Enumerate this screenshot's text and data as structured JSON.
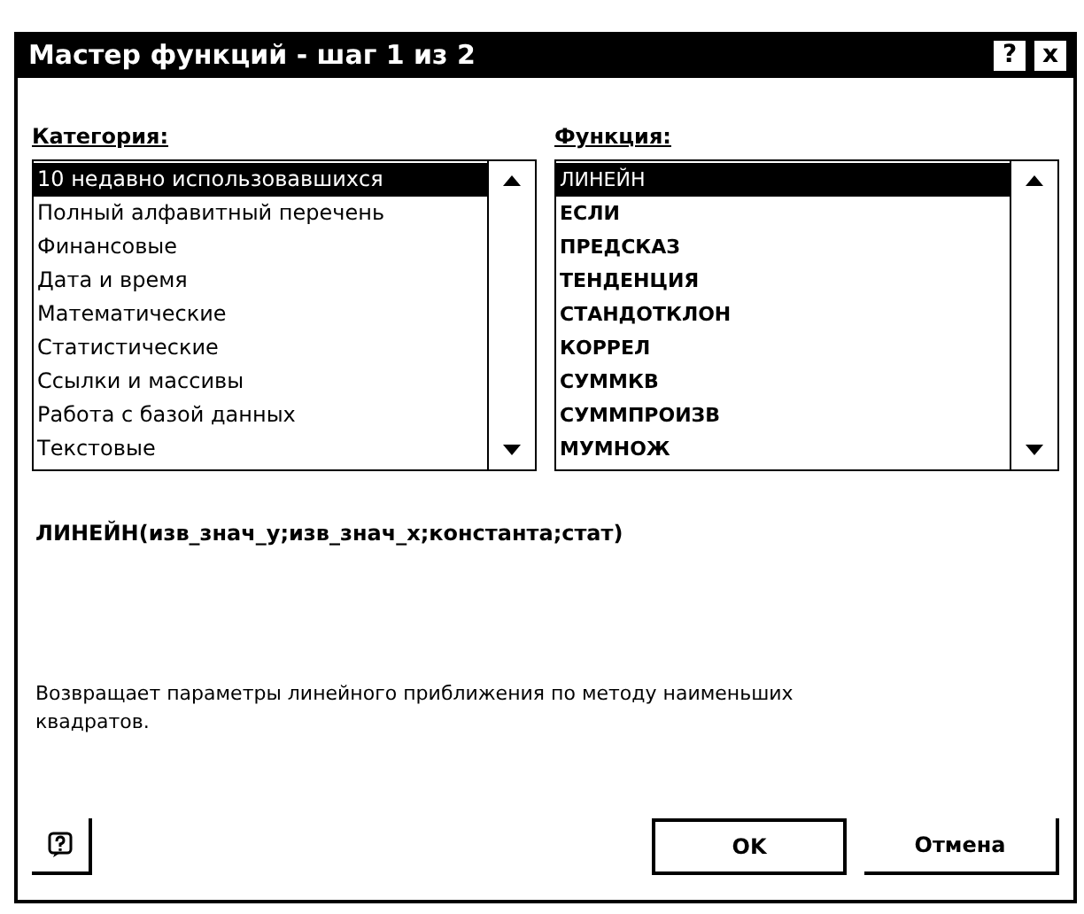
{
  "window": {
    "title": "Мастер функций - шаг 1 из 2"
  },
  "title_buttons": [
    "?",
    "x"
  ],
  "category": {
    "label": "Категория:",
    "items": [
      {
        "text": "10 недавно использовавшихся",
        "selected": true
      },
      {
        "text": "Полный алфавитный перечень",
        "selected": false
      },
      {
        "text": "Финансовые",
        "selected": false
      },
      {
        "text": "Дата и время",
        "selected": false
      },
      {
        "text": "Математические",
        "selected": false
      },
      {
        "text": "Статистические",
        "selected": false
      },
      {
        "text": "Ссылки и массивы",
        "selected": false
      },
      {
        "text": "Работа с базой данных",
        "selected": false
      },
      {
        "text": "Текстовые",
        "selected": false
      }
    ]
  },
  "function": {
    "label": "Функция:",
    "items": [
      {
        "text": "ЛИНЕЙН",
        "selected": true
      },
      {
        "text": "ЕСЛИ",
        "selected": false
      },
      {
        "text": "ПРЕДСКАЗ",
        "selected": false
      },
      {
        "text": "ТЕНДЕНЦИЯ",
        "selected": false
      },
      {
        "text": "СТАНДОТКЛОН",
        "selected": false
      },
      {
        "text": "КОРРЕЛ",
        "selected": false
      },
      {
        "text": "СУММКВ",
        "selected": false
      },
      {
        "text": "СУММПРОИЗВ",
        "selected": false
      },
      {
        "text": "МУМНОЖ",
        "selected": false
      }
    ]
  },
  "syntax": "ЛИНЕЙН(изв_знач_y;изв_знач_x;константа;стат)",
  "description": "Возвращает параметры линейного приближения по методу наименьших квадратов.",
  "buttons": [
    {
      "label": "OK",
      "default": true
    },
    {
      "label": "Отмена",
      "default": false
    }
  ]
}
